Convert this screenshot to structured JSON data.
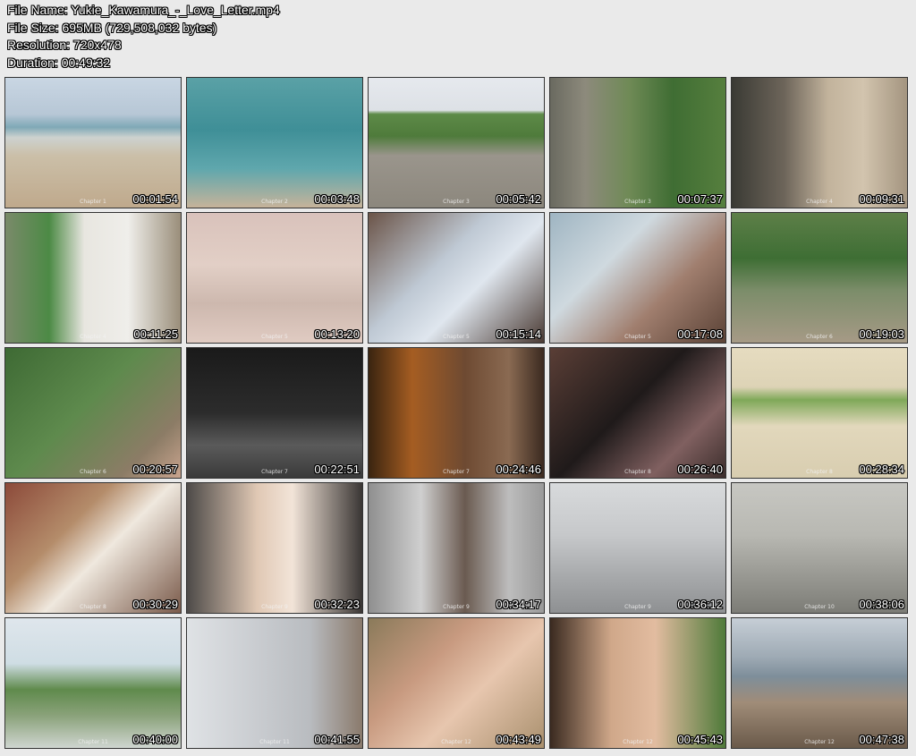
{
  "info": {
    "file_name": "File Name: Yukie_Kawamura_-_Love_Letter.mp4",
    "file_size": "File Size: 695MB (729,508,032 bytes)",
    "resolution": "Resolution: 720x478",
    "duration": "Duration: 00:49:32"
  },
  "thumbnails": [
    {
      "time": "00:01:54",
      "chapter": "Chapter 1"
    },
    {
      "time": "00:03:48",
      "chapter": "Chapter 2"
    },
    {
      "time": "00:05:42",
      "chapter": "Chapter 3"
    },
    {
      "time": "00:07:37",
      "chapter": "Chapter 3"
    },
    {
      "time": "00:09:31",
      "chapter": "Chapter 4"
    },
    {
      "time": "00:11:25",
      "chapter": "Chapter 4"
    },
    {
      "time": "00:13:20",
      "chapter": "Chapter 5"
    },
    {
      "time": "00:15:14",
      "chapter": "Chapter 5"
    },
    {
      "time": "00:17:08",
      "chapter": "Chapter 5"
    },
    {
      "time": "00:19:03",
      "chapter": "Chapter 6"
    },
    {
      "time": "00:20:57",
      "chapter": "Chapter 6"
    },
    {
      "time": "00:22:51",
      "chapter": "Chapter 7"
    },
    {
      "time": "00:24:46",
      "chapter": "Chapter 7"
    },
    {
      "time": "00:26:40",
      "chapter": "Chapter 8"
    },
    {
      "time": "00:28:34",
      "chapter": "Chapter 8"
    },
    {
      "time": "00:30:29",
      "chapter": "Chapter 8"
    },
    {
      "time": "00:32:23",
      "chapter": "Chapter 9"
    },
    {
      "time": "00:34:17",
      "chapter": "Chapter 9"
    },
    {
      "time": "00:36:12",
      "chapter": "Chapter 9"
    },
    {
      "time": "00:38:06",
      "chapter": "Chapter 10"
    },
    {
      "time": "00:40:00",
      "chapter": "Chapter 11"
    },
    {
      "time": "00:41:55",
      "chapter": "Chapter 11"
    },
    {
      "time": "00:43:49",
      "chapter": "Chapter 12"
    },
    {
      "time": "00:45:43",
      "chapter": "Chapter 12"
    },
    {
      "time": "00:47:38",
      "chapter": "Chapter 12"
    }
  ]
}
